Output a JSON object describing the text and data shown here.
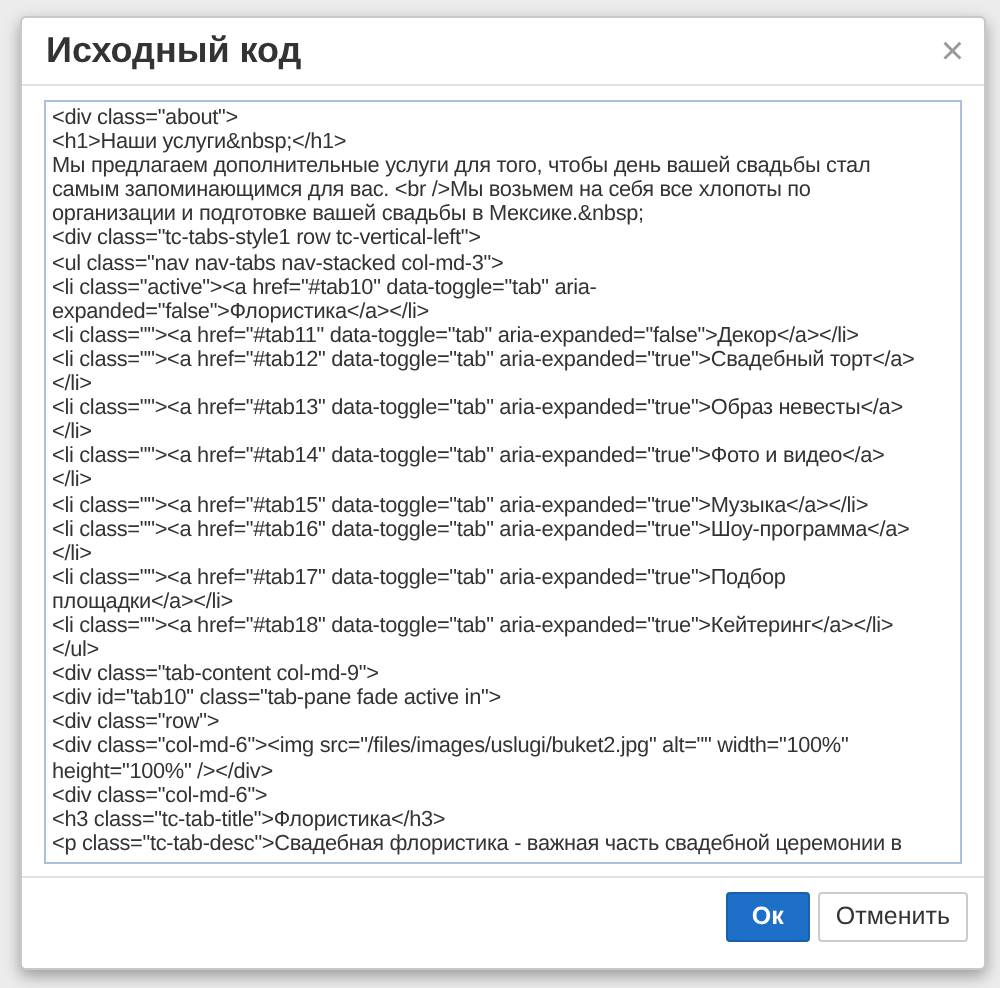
{
  "dialog": {
    "title": "Исходный код",
    "close": "×",
    "code_lines": [
      "<div class=\"about\">",
      "<h1>Наши услуги&nbsp;</h1>",
      "Мы предлагаем дополнительные услуги для того, чтобы день вашей свадьбы стал",
      "самым запоминающимся для вас. <br />Мы возьмем на себя все хлопоты по",
      "организации и подготовке вашей свадьбы в Мексике.&nbsp;",
      "<div class=\"tc-tabs-style1 row tc-vertical-left\">",
      "<ul class=\"nav nav-tabs nav-stacked col-md-3\">",
      "<li class=\"active\"><a href=\"#tab10\" data-toggle=\"tab\" aria-",
      "expanded=\"false\">Флористика</a></li>",
      "<li class=\"\"><a href=\"#tab11\" data-toggle=\"tab\" aria-expanded=\"false\">Декор</a></li>",
      "<li class=\"\"><a href=\"#tab12\" data-toggle=\"tab\" aria-expanded=\"true\">Свадебный торт</a>",
      "</li>",
      "<li class=\"\"><a href=\"#tab13\" data-toggle=\"tab\" aria-expanded=\"true\">Образ невесты</a>",
      "</li>",
      "<li class=\"\"><a href=\"#tab14\" data-toggle=\"tab\" aria-expanded=\"true\">Фото и видео</a>",
      "</li>",
      "<li class=\"\"><a href=\"#tab15\" data-toggle=\"tab\" aria-expanded=\"true\">Музыка</a></li>",
      "<li class=\"\"><a href=\"#tab16\" data-toggle=\"tab\" aria-expanded=\"true\">Шоу-программа</a>",
      "</li>",
      "<li class=\"\"><a href=\"#tab17\" data-toggle=\"tab\" aria-expanded=\"true\">Подбор",
      "площадки</a></li>",
      "<li class=\"\"><a href=\"#tab18\" data-toggle=\"tab\" aria-expanded=\"true\">Кейтеринг</a></li>",
      "</ul>",
      "<div class=\"tab-content col-md-9\">",
      "<div id=\"tab10\" class=\"tab-pane fade active in\">",
      "<div class=\"row\">",
      "<div class=\"col-md-6\"><img src=\"/files/images/uslugi/buket2.jpg\" alt=\"\" width=\"100%\"",
      "height=\"100%\" /></div>",
      "<div class=\"col-md-6\">",
      "<h3 class=\"tc-tab-title\">Флористика</h3>",
      "<p class=\"tc-tab-desc\">Свадебная флористика - важная часть свадебной церемонии в"
    ],
    "buttons": [
      {
        "label": "Ок",
        "kind": "primary"
      },
      {
        "label": "Отменить",
        "kind": "secondary"
      }
    ]
  }
}
